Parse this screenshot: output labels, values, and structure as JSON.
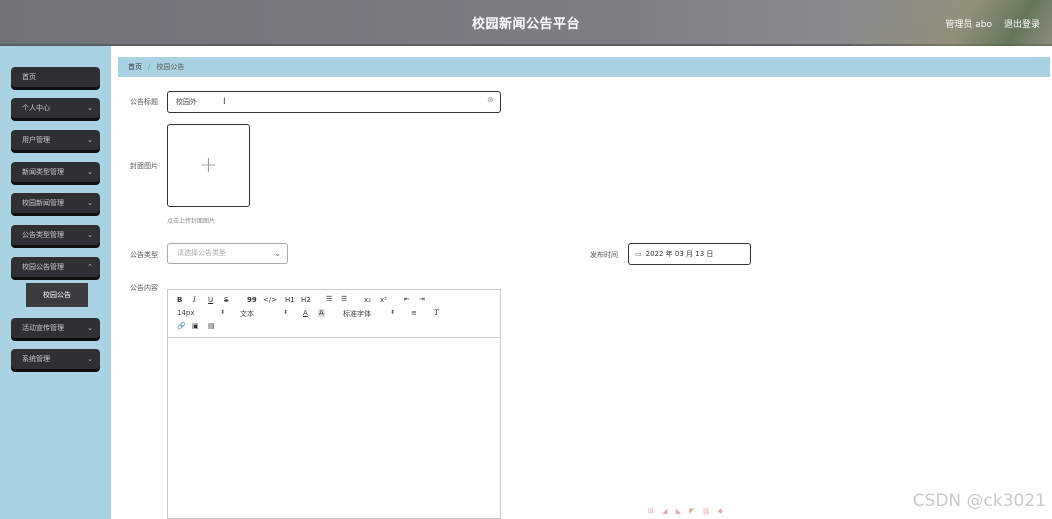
{
  "header": {
    "title": "校园新闻公告平台",
    "user_label": "管理员 abo",
    "logout_label": "退出登录"
  },
  "sidebar": {
    "items": [
      {
        "label": "首页",
        "has_chevron": false
      },
      {
        "label": "个人中心",
        "has_chevron": true
      },
      {
        "label": "用户管理",
        "has_chevron": true
      },
      {
        "label": "新闻类型管理",
        "has_chevron": true
      },
      {
        "label": "校园新闻管理",
        "has_chevron": true
      },
      {
        "label": "公告类型管理",
        "has_chevron": true
      },
      {
        "label": "校园公告管理",
        "has_chevron": true
      },
      {
        "label": "活动宣传管理",
        "has_chevron": true
      },
      {
        "label": "系统管理",
        "has_chevron": true
      }
    ],
    "submenu": {
      "label": "校园公告"
    }
  },
  "breadcrumb": {
    "home": "首页",
    "current": "校园公告"
  },
  "form": {
    "title_label": "公告标题",
    "title_value": "校园外",
    "cover_label": "封面图片",
    "cover_hint": "点击上传封面图片",
    "type_label": "公告类型",
    "type_placeholder": "请选择公告类型",
    "date_label": "发布时间",
    "date_value": "2022 年 03 月 13 日",
    "content_label": "公告内容"
  },
  "editor": {
    "toolbar_row1": [
      "B",
      "I",
      "U",
      "S",
      "99",
      "</>",
      "H1",
      "H2",
      "ol",
      "ul",
      "x₂",
      "x²",
      "outdent",
      "indent"
    ],
    "font_size": "14px",
    "text_style": "文本",
    "font_family": "标准字体"
  },
  "watermark": "CSDN @ck3021"
}
